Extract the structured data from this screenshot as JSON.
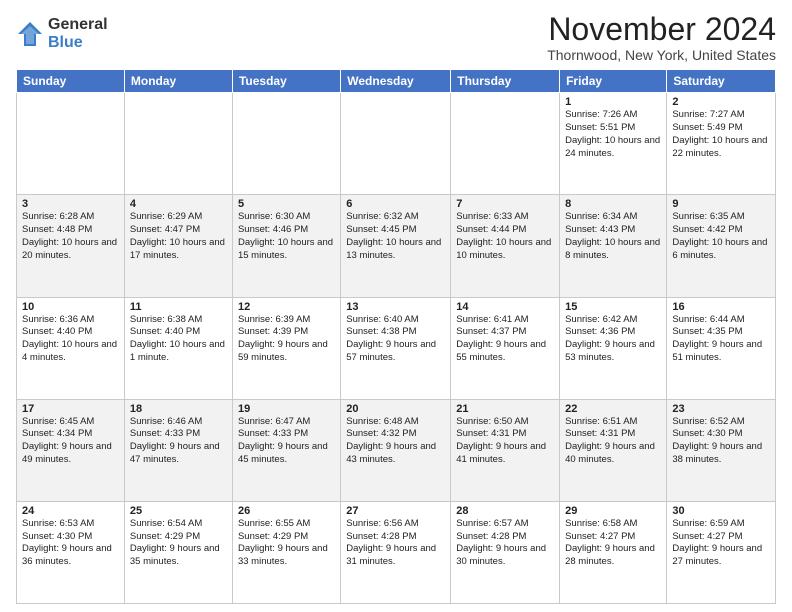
{
  "header": {
    "logo_general": "General",
    "logo_blue": "Blue",
    "month_title": "November 2024",
    "location": "Thornwood, New York, United States"
  },
  "days_of_week": [
    "Sunday",
    "Monday",
    "Tuesday",
    "Wednesday",
    "Thursday",
    "Friday",
    "Saturday"
  ],
  "weeks": [
    [
      {
        "day": "",
        "info": ""
      },
      {
        "day": "",
        "info": ""
      },
      {
        "day": "",
        "info": ""
      },
      {
        "day": "",
        "info": ""
      },
      {
        "day": "",
        "info": ""
      },
      {
        "day": "1",
        "info": "Sunrise: 7:26 AM\nSunset: 5:51 PM\nDaylight: 10 hours and 24 minutes."
      },
      {
        "day": "2",
        "info": "Sunrise: 7:27 AM\nSunset: 5:49 PM\nDaylight: 10 hours and 22 minutes."
      }
    ],
    [
      {
        "day": "3",
        "info": "Sunrise: 6:28 AM\nSunset: 4:48 PM\nDaylight: 10 hours and 20 minutes."
      },
      {
        "day": "4",
        "info": "Sunrise: 6:29 AM\nSunset: 4:47 PM\nDaylight: 10 hours and 17 minutes."
      },
      {
        "day": "5",
        "info": "Sunrise: 6:30 AM\nSunset: 4:46 PM\nDaylight: 10 hours and 15 minutes."
      },
      {
        "day": "6",
        "info": "Sunrise: 6:32 AM\nSunset: 4:45 PM\nDaylight: 10 hours and 13 minutes."
      },
      {
        "day": "7",
        "info": "Sunrise: 6:33 AM\nSunset: 4:44 PM\nDaylight: 10 hours and 10 minutes."
      },
      {
        "day": "8",
        "info": "Sunrise: 6:34 AM\nSunset: 4:43 PM\nDaylight: 10 hours and 8 minutes."
      },
      {
        "day": "9",
        "info": "Sunrise: 6:35 AM\nSunset: 4:42 PM\nDaylight: 10 hours and 6 minutes."
      }
    ],
    [
      {
        "day": "10",
        "info": "Sunrise: 6:36 AM\nSunset: 4:40 PM\nDaylight: 10 hours and 4 minutes."
      },
      {
        "day": "11",
        "info": "Sunrise: 6:38 AM\nSunset: 4:40 PM\nDaylight: 10 hours and 1 minute."
      },
      {
        "day": "12",
        "info": "Sunrise: 6:39 AM\nSunset: 4:39 PM\nDaylight: 9 hours and 59 minutes."
      },
      {
        "day": "13",
        "info": "Sunrise: 6:40 AM\nSunset: 4:38 PM\nDaylight: 9 hours and 57 minutes."
      },
      {
        "day": "14",
        "info": "Sunrise: 6:41 AM\nSunset: 4:37 PM\nDaylight: 9 hours and 55 minutes."
      },
      {
        "day": "15",
        "info": "Sunrise: 6:42 AM\nSunset: 4:36 PM\nDaylight: 9 hours and 53 minutes."
      },
      {
        "day": "16",
        "info": "Sunrise: 6:44 AM\nSunset: 4:35 PM\nDaylight: 9 hours and 51 minutes."
      }
    ],
    [
      {
        "day": "17",
        "info": "Sunrise: 6:45 AM\nSunset: 4:34 PM\nDaylight: 9 hours and 49 minutes."
      },
      {
        "day": "18",
        "info": "Sunrise: 6:46 AM\nSunset: 4:33 PM\nDaylight: 9 hours and 47 minutes."
      },
      {
        "day": "19",
        "info": "Sunrise: 6:47 AM\nSunset: 4:33 PM\nDaylight: 9 hours and 45 minutes."
      },
      {
        "day": "20",
        "info": "Sunrise: 6:48 AM\nSunset: 4:32 PM\nDaylight: 9 hours and 43 minutes."
      },
      {
        "day": "21",
        "info": "Sunrise: 6:50 AM\nSunset: 4:31 PM\nDaylight: 9 hours and 41 minutes."
      },
      {
        "day": "22",
        "info": "Sunrise: 6:51 AM\nSunset: 4:31 PM\nDaylight: 9 hours and 40 minutes."
      },
      {
        "day": "23",
        "info": "Sunrise: 6:52 AM\nSunset: 4:30 PM\nDaylight: 9 hours and 38 minutes."
      }
    ],
    [
      {
        "day": "24",
        "info": "Sunrise: 6:53 AM\nSunset: 4:30 PM\nDaylight: 9 hours and 36 minutes."
      },
      {
        "day": "25",
        "info": "Sunrise: 6:54 AM\nSunset: 4:29 PM\nDaylight: 9 hours and 35 minutes."
      },
      {
        "day": "26",
        "info": "Sunrise: 6:55 AM\nSunset: 4:29 PM\nDaylight: 9 hours and 33 minutes."
      },
      {
        "day": "27",
        "info": "Sunrise: 6:56 AM\nSunset: 4:28 PM\nDaylight: 9 hours and 31 minutes."
      },
      {
        "day": "28",
        "info": "Sunrise: 6:57 AM\nSunset: 4:28 PM\nDaylight: 9 hours and 30 minutes."
      },
      {
        "day": "29",
        "info": "Sunrise: 6:58 AM\nSunset: 4:27 PM\nDaylight: 9 hours and 28 minutes."
      },
      {
        "day": "30",
        "info": "Sunrise: 6:59 AM\nSunset: 4:27 PM\nDaylight: 9 hours and 27 minutes."
      }
    ]
  ]
}
